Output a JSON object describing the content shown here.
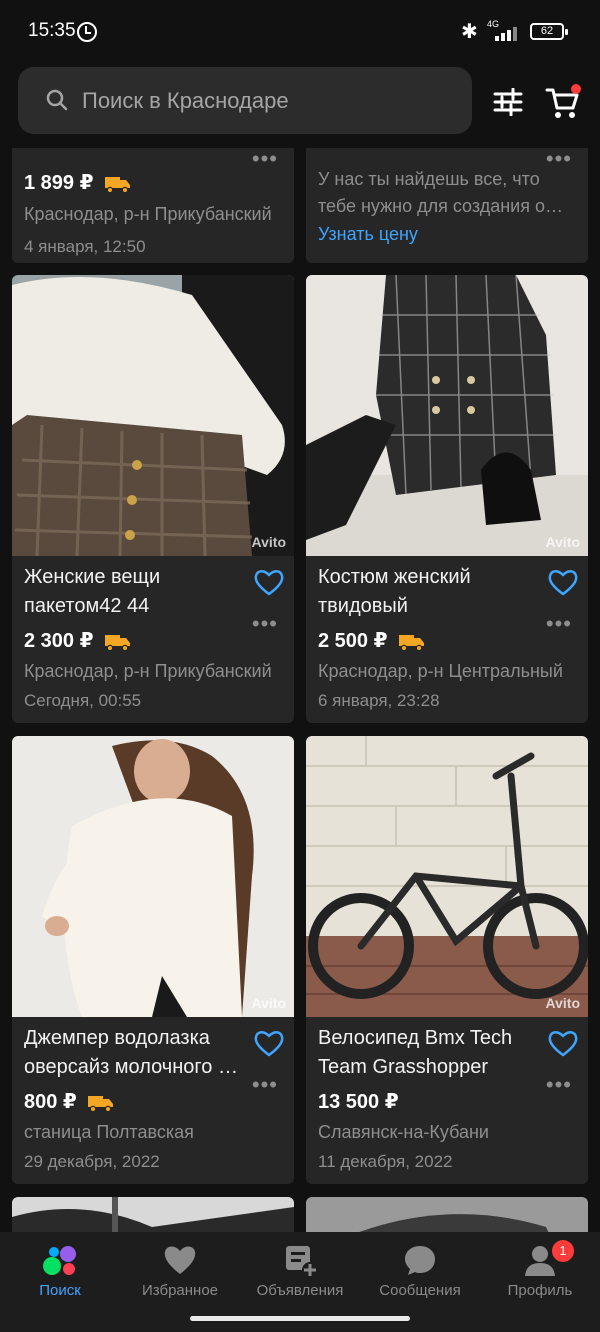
{
  "status_bar": {
    "time": "15:35",
    "network": "4G",
    "battery": "62"
  },
  "search": {
    "placeholder": "Поиск в Краснодаре"
  },
  "watermark": "Avito",
  "top_cards": [
    {
      "price": "1 899 ₽",
      "delivery": true,
      "location": "Краснодар, р-н Прикубанский",
      "date": "4 января, 12:50"
    },
    {
      "desc_lines": [
        "У нас ты найдешь все, что",
        "тебе нужно для создания образа"
      ],
      "link": "Узнать цену"
    }
  ],
  "cards": [
    {
      "title_lines": [
        "Женские вещи",
        "пакетом42 44"
      ],
      "price": "2 300 ₽",
      "delivery": true,
      "location": "Краснодар, р-н Прикубанский",
      "date": "Сегодня, 00:55"
    },
    {
      "title_lines": [
        "Костюм женский",
        "твидовый"
      ],
      "price": "2 500 ₽",
      "delivery": true,
      "location": "Краснодар, р-н Центральный",
      "date": "6 января, 23:28"
    },
    {
      "title_lines": [
        "Джемпер водолазка",
        "оверсайз молочного цвета"
      ],
      "price": "800 ₽",
      "delivery": true,
      "location": "станица Полтавская",
      "date": "29 декабря, 2022"
    },
    {
      "title_lines": [
        "Велосипед Bmx Tech",
        "Team Grasshopper"
      ],
      "price": "13 500 ₽",
      "delivery": false,
      "location": "Славянск-на-Кубани",
      "date": "11 декабря, 2022"
    }
  ],
  "bottom_nav": {
    "items": [
      {
        "label": "Поиск",
        "icon": "search-colored-dots-icon",
        "active": true
      },
      {
        "label": "Избранное",
        "icon": "heart-icon",
        "active": false
      },
      {
        "label": "Объявления",
        "icon": "listing-add-icon",
        "active": false
      },
      {
        "label": "Сообщения",
        "icon": "chat-bubble-icon",
        "active": false
      },
      {
        "label": "Профиль",
        "icon": "profile-icon",
        "active": false,
        "badge": "1"
      }
    ]
  },
  "colors": {
    "accent": "#3fa5ff",
    "delivery": "#f5a623",
    "badge": "#ff3b3b",
    "card_bg": "#262626"
  }
}
